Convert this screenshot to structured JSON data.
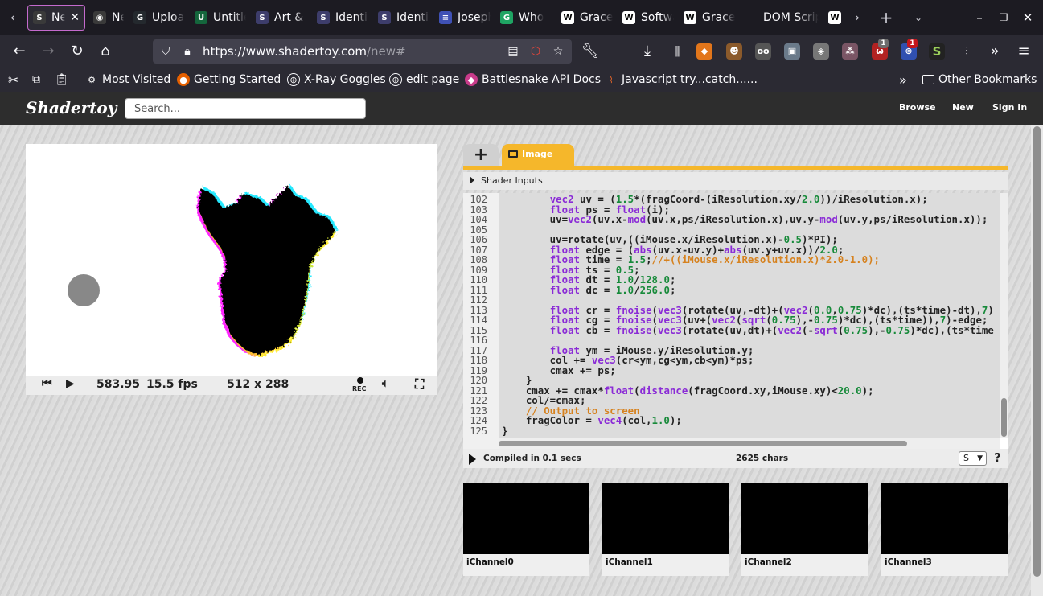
{
  "browser": {
    "tabs": [
      {
        "title": "New Shader",
        "icon": "S",
        "active": true
      },
      {
        "title": "New Tab",
        "icon": "◉"
      },
      {
        "title": "Upload",
        "icon": "G"
      },
      {
        "title": "Untitled",
        "icon": "U"
      },
      {
        "title": "Art & Shaders",
        "icon": "S"
      },
      {
        "title": "Identicon",
        "icon": "S"
      },
      {
        "title": "Identicon",
        "icon": "S"
      },
      {
        "title": "Joseph",
        "icon": "≡"
      },
      {
        "title": "Who",
        "icon": "G"
      },
      {
        "title": "Grace",
        "icon": "W"
      },
      {
        "title": "Software",
        "icon": "W"
      },
      {
        "title": "Grace",
        "icon": "W"
      },
      {
        "title": "DOM Scripting",
        "icon": ""
      },
      {
        "title": "",
        "icon": "W"
      }
    ],
    "url_host": "https://www.shadertoy.com",
    "url_path": "/new#",
    "bookmarks": [
      "Most Visited",
      "Getting Started",
      "X-Ray Goggles",
      "edit page",
      "Battlesnake API Docs",
      "Javascript try...catch......"
    ],
    "other_bookmarks": "Other Bookmarks",
    "extension_badges": [
      "1",
      "1"
    ]
  },
  "site": {
    "logo": "Shadertoy",
    "search_placeholder": "Search...",
    "nav": [
      "Browse",
      "New",
      "Sign In"
    ]
  },
  "player": {
    "time": "583.95",
    "fps": "15.5 fps",
    "resolution": "512 x 288",
    "rec_label": "REC"
  },
  "editor": {
    "plus_tab": "+",
    "image_tab": "Image",
    "shader_inputs": "Shader Inputs",
    "compile_status": "Compiled in 0.1 secs",
    "char_count": "2625 chars",
    "font_size_option": "S",
    "help": "?"
  },
  "channels": [
    "iChannel0",
    "iChannel1",
    "iChannel2",
    "iChannel3"
  ],
  "code": {
    "line_numbers": [
      "102",
      "103",
      "104",
      "105",
      "106",
      "107",
      "108",
      "109",
      "110",
      "111",
      "112",
      "113",
      "114",
      "115",
      "116",
      "117",
      "118",
      "119",
      "120",
      "121",
      "122",
      "123",
      "124",
      "125"
    ],
    "lines": [
      "        vec2 uv = (1.5*(fragCoord-(iResolution.xy/2.0))/iResolution.x);",
      "        float ps = float(i);",
      "        uv=vec2(uv.x-mod(uv.x,ps/iResolution.x),uv.y-mod(uv.y,ps/iResolution.x));",
      "",
      "        uv=rotate(uv,((iMouse.x/iResolution.x)-0.5)*PI);",
      "        float edge = (abs(uv.x-uv.y)+abs(uv.y+uv.x))/2.0;",
      "        float time = 1.5;//+((iMouse.x/iResolution.x)*2.0-1.0);",
      "        float ts = 0.5;",
      "        float dt = 1.0/128.0;",
      "        float dc = 1.0/256.0;",
      "",
      "        float cr = fnoise(vec3(rotate(uv,-dt)+(vec2(0.0,0.75)*dc),(ts*time)-dt),7)",
      "        float cg = fnoise(vec3(uv+(vec2(sqrt(0.75),-0.75)*dc),(ts*time)),7)-edge;",
      "        float cb = fnoise(vec3(rotate(uv,dt)+(vec2(-sqrt(0.75),-0.75)*dc),(ts*time",
      "",
      "        float ym = iMouse.y/iResolution.y;",
      "        col += vec3(cr<ym,cg<ym,cb<ym)*ps;",
      "        cmax += ps;",
      "    }",
      "    cmax += cmax*float(distance(fragCoord.xy,iMouse.xy)<20.0);",
      "    col/=cmax;",
      "    // Output to screen",
      "    fragColor = vec4(col,1.0);",
      "}"
    ]
  },
  "colors": {
    "accent": "#f5b72b",
    "header_bg": "#2d2d2d",
    "browser_bg": "#1c1b22",
    "code_bg": "#dcdcdc"
  }
}
